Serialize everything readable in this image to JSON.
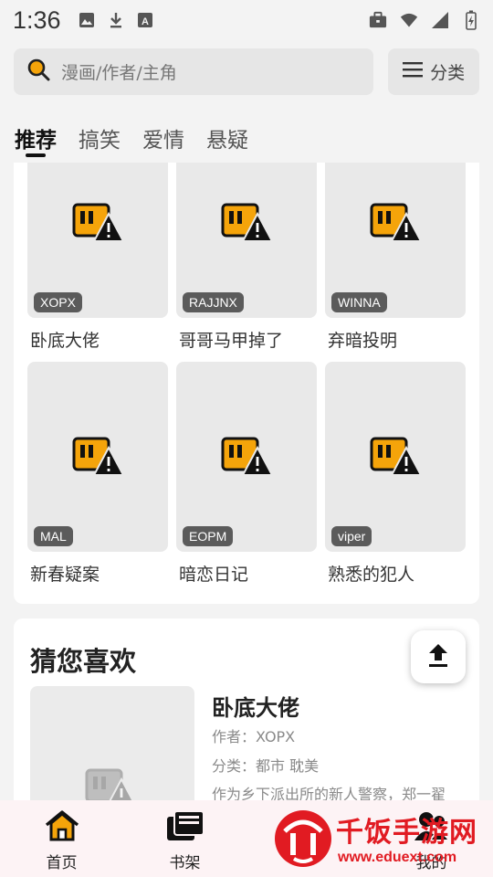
{
  "status_bar": {
    "time": "1:36",
    "left_icons": [
      "image-icon",
      "download-icon",
      "font-icon"
    ],
    "right_icons": [
      "briefcase-icon",
      "wifi-icon",
      "signal-icon",
      "battery-icon"
    ]
  },
  "search": {
    "placeholder": "漫画/作者/主角"
  },
  "header": {
    "category_label": "分类"
  },
  "tabs": [
    {
      "label": "推荐",
      "active": true
    },
    {
      "label": "搞笑",
      "active": false
    },
    {
      "label": "爱情",
      "active": false
    },
    {
      "label": "悬疑",
      "active": false
    }
  ],
  "comics": [
    {
      "title": "卧底大佬",
      "author": "XOPX"
    },
    {
      "title": "哥哥马甲掉了",
      "author": "RAJJNX"
    },
    {
      "title": "弃暗投明",
      "author": "WINNA"
    },
    {
      "title": "新春疑案",
      "author": "MAL"
    },
    {
      "title": "暗恋日记",
      "author": "EOPM"
    },
    {
      "title": "熟悉的犯人",
      "author": "viper"
    }
  ],
  "recommend": {
    "heading": "猜您喜欢",
    "item": {
      "title": "卧底大佬",
      "author_line": "作者：XOPX",
      "category_line": "分类：都市 耽美",
      "description": "作为乡下派出所的新人警察，郑一翟"
    }
  },
  "bottom_nav": [
    {
      "label": "首页",
      "icon": "home-icon"
    },
    {
      "label": "书架",
      "icon": "bookshelf-icon"
    },
    {
      "label": "",
      "icon": "headset-icon"
    },
    {
      "label": "我的",
      "icon": "profile-icon"
    }
  ],
  "watermark": {
    "name": "千饭手游网",
    "url": "www.eduext.com"
  },
  "colors": {
    "accent": "#f5a40a",
    "watermark": "#e11b22",
    "nav_bg": "#fdf3f5"
  }
}
